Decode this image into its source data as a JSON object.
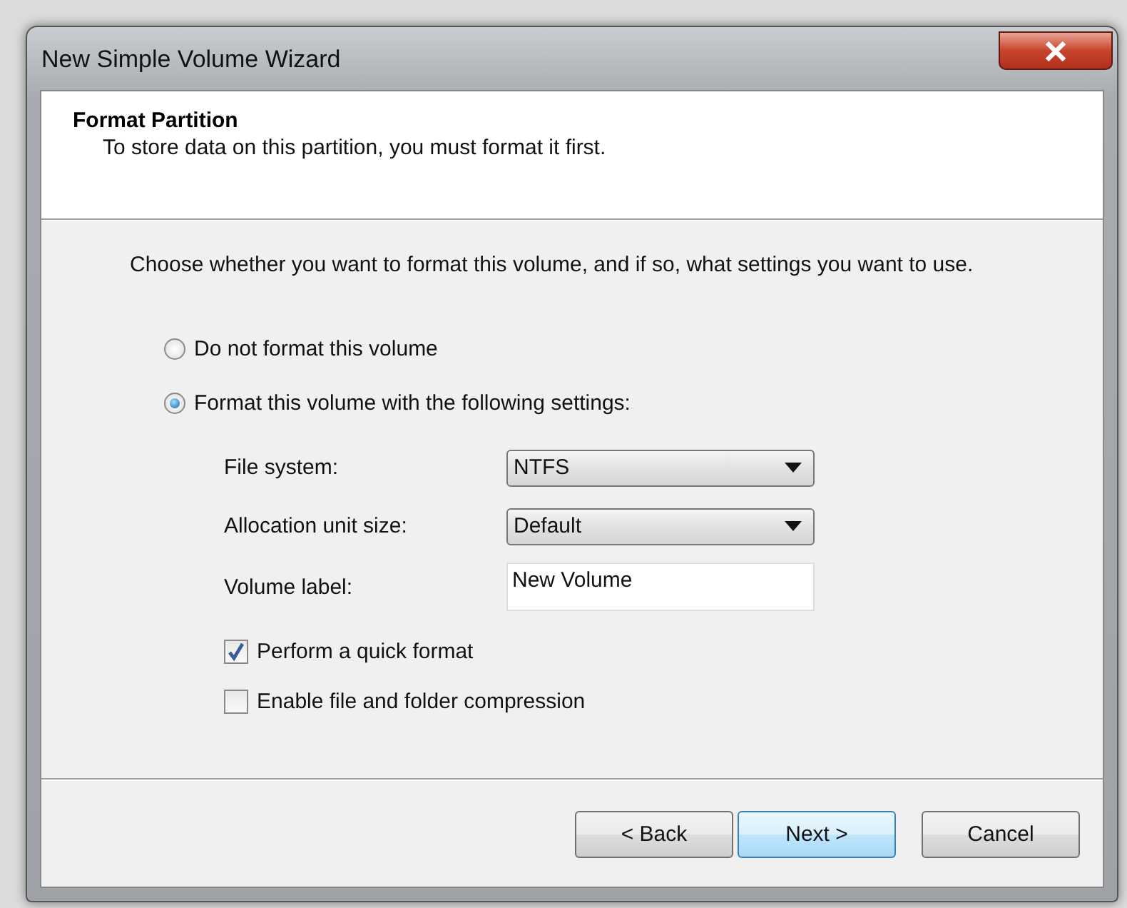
{
  "window": {
    "title": "New Simple Volume Wizard"
  },
  "header": {
    "title": "Format Partition",
    "subtitle": "To store data on this partition, you must format it first."
  },
  "instruction": "Choose whether you want to format this volume, and if so, what settings you want to use.",
  "format_options": [
    {
      "label": "Do not format this volume",
      "selected": false
    },
    {
      "label": "Format this volume with the following settings:",
      "selected": true
    }
  ],
  "settings": [
    {
      "kind": "dropdown",
      "label": "File system:",
      "value": "NTFS"
    },
    {
      "kind": "dropdown",
      "label": "Allocation unit size:",
      "value": "Default"
    },
    {
      "kind": "text",
      "label": "Volume label:",
      "value": "New Volume"
    }
  ],
  "checkboxes": [
    {
      "label": "Perform a quick format",
      "checked": true
    },
    {
      "label": "Enable file and folder compression",
      "checked": false
    }
  ],
  "buttons": [
    {
      "label": "< Back",
      "default": false
    },
    {
      "label": "Next >",
      "default": true
    },
    {
      "label": "Cancel",
      "default": false
    }
  ]
}
